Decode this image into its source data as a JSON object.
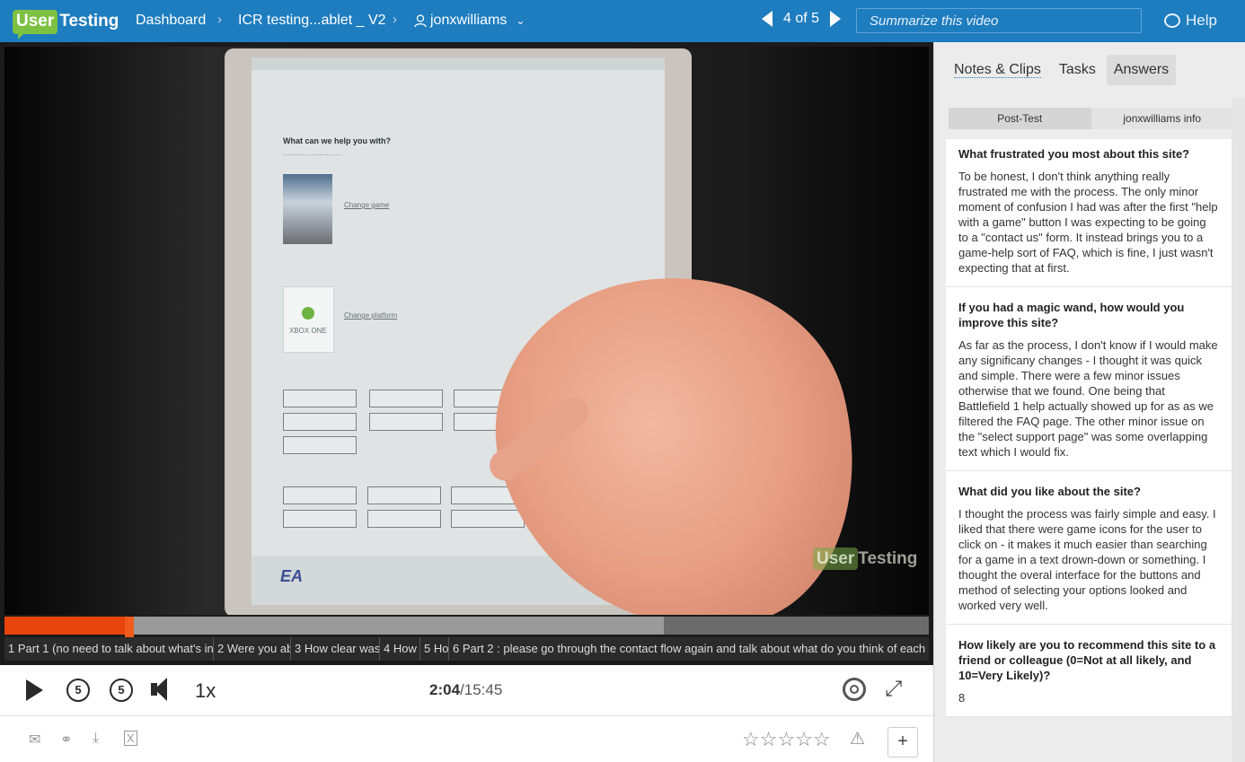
{
  "header": {
    "logo_user": "User",
    "logo_testing": "Testing",
    "breadcrumbs": [
      "Dashboard",
      "ICR testing...ablet _ V2",
      "jonxwilliams"
    ],
    "pager": "4 of 5",
    "summarize_placeholder": "Summarize this video",
    "help": "Help"
  },
  "video": {
    "watermark_user": "User",
    "watermark_testing": "Testing",
    "progress_fraction": 0.132,
    "buffer_fraction": 0.713,
    "screen": {
      "heading": "What can we help you with?",
      "change_game": "Change game",
      "change_platform": "Change platform",
      "xbox_label": "XBOX ONE",
      "ea_logo": "EA"
    },
    "chapters": [
      "1 Part 1 (no need to talk about what's in y",
      "2 Were you ab",
      "3 How clear was",
      "4 How",
      "5 Ho",
      "6 Part 2 : please go through the contact flow again and talk about what do you think of each r"
    ]
  },
  "controls": {
    "skip_back": "5",
    "skip_forward": "5",
    "speed": "1x",
    "time_current": "2:04",
    "time_total": "/15:45"
  },
  "panel": {
    "tabs": [
      "Notes & Clips",
      "Tasks",
      "Answers"
    ],
    "subtabs": [
      "Post-Test",
      "jonxwilliams info"
    ],
    "answers": [
      {
        "question": "What frustrated you most about this site?",
        "answer": "To be honest, I don't think anything really frustrated me with the process. The only minor moment of confusion I had was after the first \"help with a game\" button I was expecting to be going to a \"contact us\" form. It instead brings you to a game-help sort of FAQ, which is fine, I just wasn't expecting that at first."
      },
      {
        "question": "If you had a magic wand, how would you improve this site?",
        "answer": "As far as the process, I don't know if I would make any significany changes - I thought it was quick and simple. There were a few minor issues otherwise that we found. One being that Battlefield 1 help actually showed up for as as we filtered the FAQ page. The other minor issue on the \"select support page\" was some overlapping text which I would fix."
      },
      {
        "question": "What did you like about the site?",
        "answer": "I thought the process was fairly simple and easy. I liked that there were game icons for the user to click on - it makes it much easier than searching for a game in a text drown-down or something. I thought the overal interface for the buttons and method of selecting your options looked and worked very well."
      },
      {
        "question": "How likely are you to recommend this site to a friend or colleague (0=Not at all likely, and 10=Very Likely)?",
        "answer": "8"
      }
    ]
  },
  "icons": {
    "mail": "mail-icon",
    "link": "link-icon",
    "download": "download-icon",
    "excel": "excel-icon",
    "rating": "star-icon",
    "flag": "warning-icon",
    "add": "plus-icon"
  },
  "colors": {
    "header_bg": "#1e7dbf",
    "progress": "#e8450c",
    "logo_green": "#7cc142"
  }
}
